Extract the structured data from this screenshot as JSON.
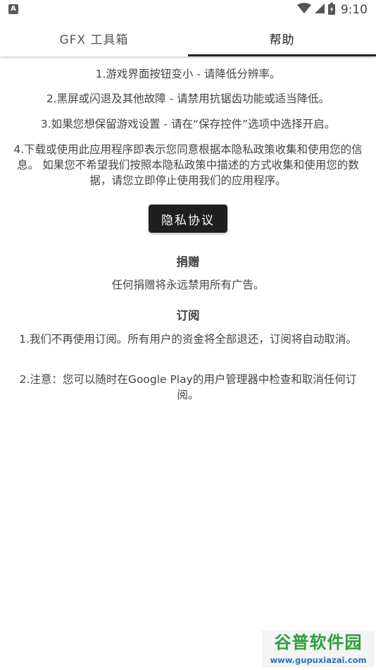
{
  "status_bar": {
    "notification_icon_letter": "A",
    "time": "9:10",
    "icons": [
      "wifi-icon",
      "signal-icon",
      "battery-icon"
    ]
  },
  "tabs": [
    {
      "label": "GFX 工具箱",
      "active": false
    },
    {
      "label": "帮助",
      "active": true
    }
  ],
  "help": {
    "items": [
      "1.游戏界面按钮变小 - 请降低分辨率。",
      "2.黑屏或闪退及其他故障 - 请禁用抗锯齿功能或适当降低。",
      "3.如果您想保留游戏设置 - 请在“保存控件”选项中选择开启。",
      "4.下载或使用此应用程序即表示您同意根据本隐私政策收集和使用您的信息。 如果您不希望我们按照本隐私政策中描述的方式收集和使用您的数据，请您立即停止使用我们的应用程序。"
    ],
    "privacy_button": "隐私协议",
    "donate": {
      "heading": "捐赠",
      "text": "任何捐赠将永远禁用所有广告。"
    },
    "subscription": {
      "heading": "订阅",
      "items": [
        "1.我们不再使用订阅。所有用户的资金将全部退还，订阅将自动取消。",
        "2.注意：您可以随时在Google Play的用户管理器中检查和取消任何订阅。"
      ]
    }
  },
  "watermark": {
    "title": "谷普软件园",
    "url": "www.gupuxiazai.com"
  },
  "colors": {
    "tab_indicator": "#222222",
    "button_bg": "#1f1f1f",
    "watermark_green": "#2e9e3c",
    "watermark_blue": "#2e6fbf"
  }
}
